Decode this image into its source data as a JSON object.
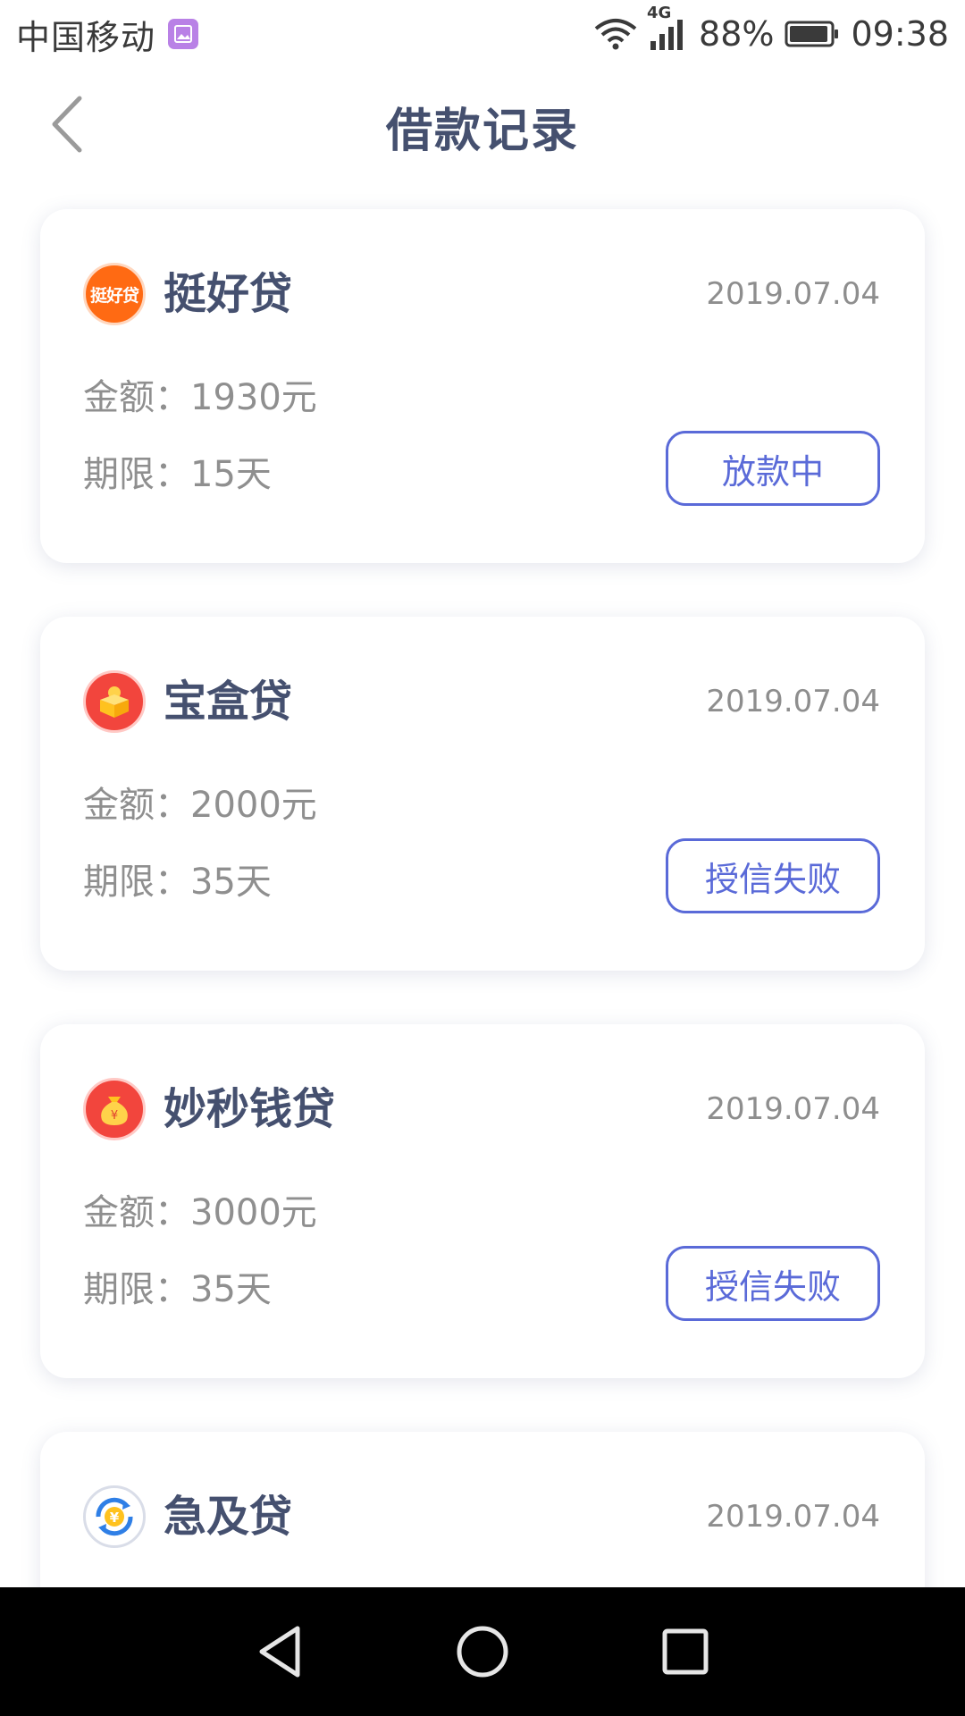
{
  "status_bar": {
    "carrier": "中国移动",
    "network": "4G",
    "battery": "88%",
    "time": "09:38"
  },
  "header": {
    "title": "借款记录"
  },
  "loans": [
    {
      "name": "挺好贷",
      "logo_text": "挺好贷",
      "date": "2019.07.04",
      "amount_label": "金额：",
      "amount_value": "1930元",
      "term_label": "期限：",
      "term_value": "15天",
      "status": "放款中"
    },
    {
      "name": "宝盒贷",
      "date": "2019.07.04",
      "amount_label": "金额：",
      "amount_value": "2000元",
      "term_label": "期限：",
      "term_value": "35天",
      "status": "授信失败"
    },
    {
      "name": "妙秒钱贷",
      "date": "2019.07.04",
      "amount_label": "金额：",
      "amount_value": "3000元",
      "term_label": "期限：",
      "term_value": "35天",
      "status": "授信失败"
    },
    {
      "name": "急及贷",
      "date": "2019.07.04"
    }
  ],
  "colors": {
    "title": "#45506f",
    "accent": "#5a6ad8",
    "muted": "#8f8f8f"
  }
}
